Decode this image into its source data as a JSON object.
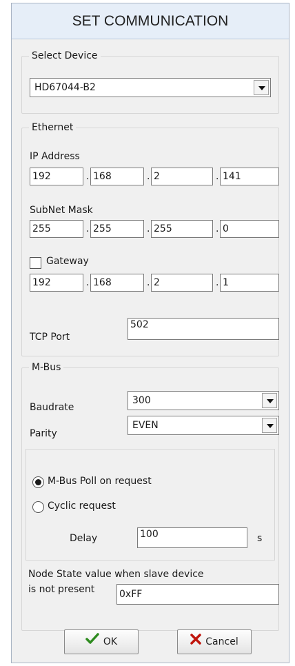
{
  "window": {
    "title": "SET COMMUNICATION"
  },
  "device": {
    "legend": "Select Device",
    "selected": "HD67044-B2"
  },
  "ethernet": {
    "legend": "Ethernet",
    "ip_label": "IP Address",
    "ip": [
      "192",
      "168",
      "2",
      "141"
    ],
    "subnet_label": "SubNet Mask",
    "subnet": [
      "255",
      "255",
      "255",
      "0"
    ],
    "gateway_label": "Gateway",
    "gateway_checked": false,
    "gateway": [
      "192",
      "168",
      "2",
      "1"
    ],
    "tcp_port_label": "TCP Port",
    "tcp_port": "502",
    "separator": "."
  },
  "mbus": {
    "legend": "M-Bus",
    "baudrate_label": "Baudrate",
    "baudrate": "300",
    "parity_label": "Parity",
    "parity": "EVEN",
    "poll_on_request_label": "M-Bus Poll on request",
    "cyclic_request_label": "Cyclic request",
    "selected_mode": "poll_on_request",
    "delay_label": "Delay",
    "delay": "100",
    "delay_unit": "s",
    "node_state_label_line1": "Node State value when slave device",
    "node_state_label_line2": "is not present",
    "node_state_value": "0xFF"
  },
  "buttons": {
    "ok_label": "OK",
    "cancel_label": "Cancel"
  },
  "colors": {
    "ok_check": "#2e8b1f",
    "cancel_x": "#c0150c"
  }
}
